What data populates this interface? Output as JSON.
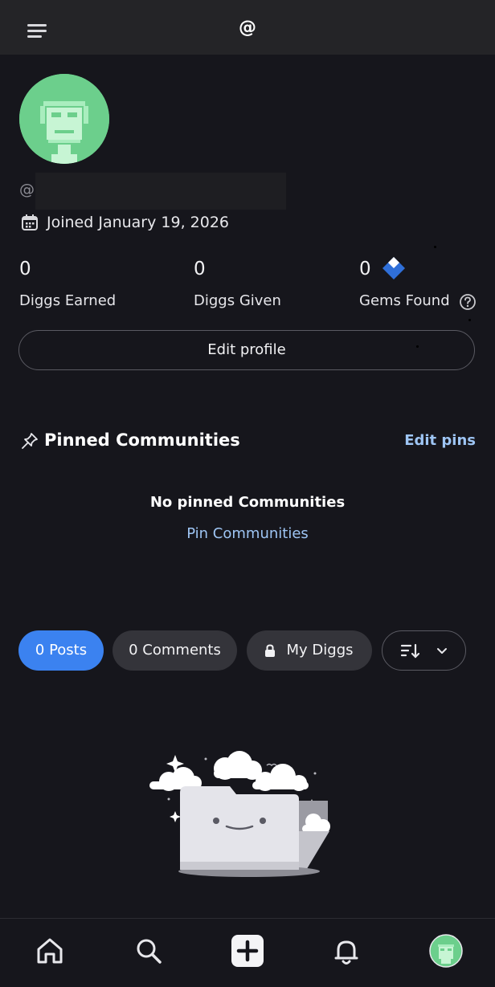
{
  "header": {
    "title": "@",
    "menu_icon": "hamburger-menu-icon"
  },
  "profile": {
    "avatar_color": "#6ccf8c",
    "handle_prefix": "@",
    "joined_text": "Joined January 19, 2026",
    "stats": [
      {
        "value": "0",
        "label": "Diggs Earned"
      },
      {
        "value": "0",
        "label": "Diggs Given"
      },
      {
        "value": "0",
        "label": "Gems Found"
      }
    ],
    "edit_profile_label": "Edit profile"
  },
  "pinned": {
    "title": "Pinned Communities",
    "edit_label": "Edit pins",
    "empty_title": "No pinned Communities",
    "pin_link": "Pin Communities"
  },
  "tabs": {
    "posts": "0 Posts",
    "comments": "0 Comments",
    "diggs": "My Diggs",
    "sort_icon": "sort-icon"
  },
  "bottom_nav": {
    "items": [
      "home-icon",
      "search-icon",
      "create-icon",
      "notifications-icon",
      "profile-avatar"
    ]
  },
  "colors": {
    "accent_blue": "#3b82f0",
    "link_blue": "#9ec5f4",
    "background": "#16161c",
    "gem_blue": "#2f6fd8"
  }
}
